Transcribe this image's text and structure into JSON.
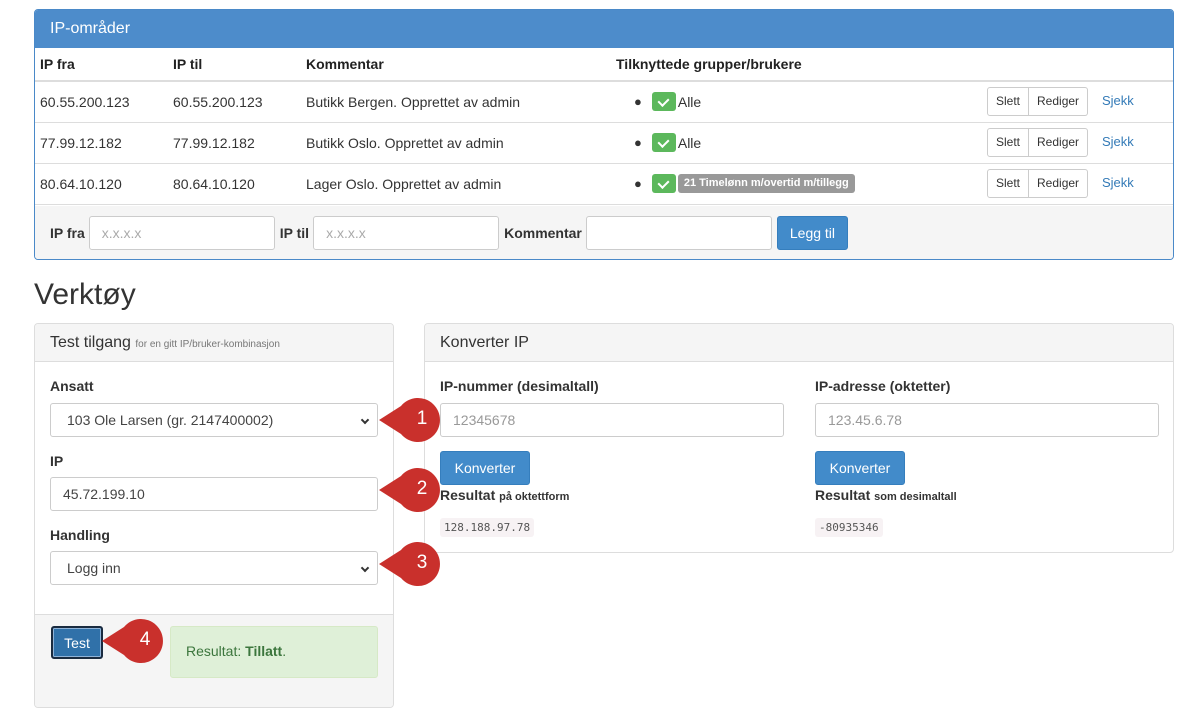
{
  "ip_panel": {
    "title": "IP-områder",
    "columns": [
      "IP fra",
      "IP til",
      "Kommentar",
      "Tilknyttede grupper/brukere"
    ],
    "rows": [
      {
        "from": "60.55.200.123",
        "to": "60.55.200.123",
        "comment": "Butikk Bergen. Opprettet av admin",
        "group_label": "Alle",
        "group_is_badge": false
      },
      {
        "from": "77.99.12.182",
        "to": "77.99.12.182",
        "comment": "Butikk Oslo. Opprettet av admin",
        "group_label": "Alle",
        "group_is_badge": false
      },
      {
        "from": "80.64.10.120",
        "to": "80.64.10.120",
        "comment": "Lager Oslo. Opprettet av admin",
        "group_label": "21 Timelønn m/overtid m/tillegg",
        "group_is_badge": true
      }
    ],
    "row_actions": {
      "delete": "Slett",
      "edit": "Rediger",
      "check": "Sjekk"
    },
    "add_form": {
      "from_label": "IP fra",
      "from_placeholder": "x.x.x.x",
      "to_label": "IP til",
      "to_placeholder": "x.x.x.x",
      "comment_label": "Kommentar",
      "comment_placeholder": "",
      "add_button": "Legg til"
    }
  },
  "tools": {
    "title": "Verktøy",
    "test_access": {
      "title": "Test tilgang",
      "subtitle": "for en gitt IP/bruker-kombinasjon",
      "employee_label": "Ansatt",
      "employee_value": "103 Ole Larsen (gr. 2147400002)",
      "ip_label": "IP",
      "ip_value": "45.72.199.10",
      "action_label": "Handling",
      "action_value": "Logg inn",
      "test_button": "Test",
      "result_prefix": "Resultat:",
      "result_value": "Tillatt",
      "result_suffix": "."
    },
    "convert_ip": {
      "title": "Konverter IP",
      "decimal_label": "IP-nummer (desimaltall)",
      "decimal_placeholder": "12345678",
      "octet_label": "IP-adresse (oktetter)",
      "octet_placeholder": "123.45.6.78",
      "convert_button": "Konverter",
      "result_label": "Resultat",
      "result_octet_suffix": "på oktettform",
      "result_decimal_suffix": "som desimaltall",
      "result_octet_value": "128.188.97.78",
      "result_decimal_value": "-80935346"
    }
  },
  "callouts": [
    "1",
    "2",
    "3",
    "4"
  ],
  "colors": {
    "primary": "#428bca",
    "panel_header": "#4d8ccb",
    "success": "#5cb85c",
    "callout": "#c9302c"
  }
}
